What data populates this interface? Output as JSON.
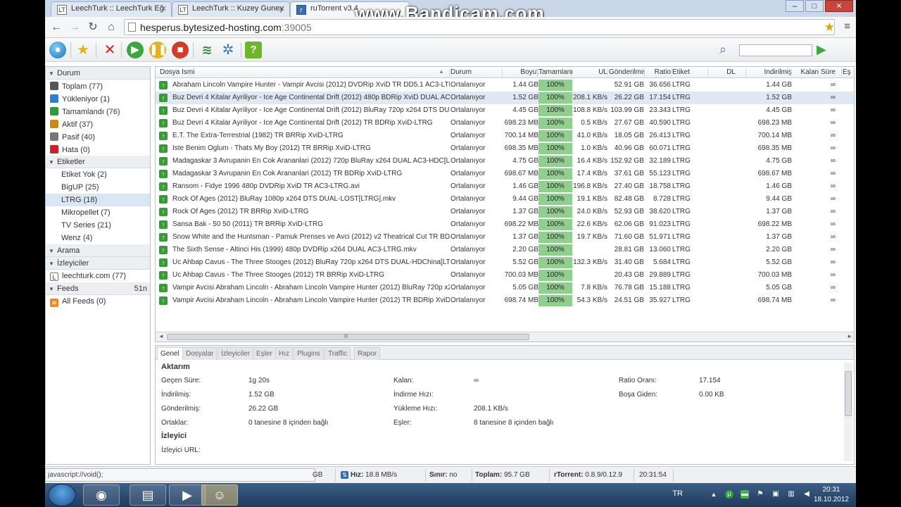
{
  "browser": {
    "tabs": [
      {
        "label": "LeechTurk :: LeechTurk Eğ",
        "favicon": "LT"
      },
      {
        "label": "LeechTurk :: Kuzey Guney",
        "favicon": "LT"
      },
      {
        "label": "ruTorrent v3.4",
        "favicon": "r"
      }
    ],
    "url_host": "hesperus.bytesized-hosting.com",
    "url_port": ":39005",
    "watermark": "www.Bandicam.com",
    "icons": {
      "back": "back-icon",
      "forward": "forward-icon",
      "reload": "reload-icon",
      "home": "home-icon",
      "star": "bookmark-star-icon",
      "wrench": "wrench-menu-icon"
    }
  },
  "sidebar": {
    "status_header": "Durum",
    "status_items": [
      {
        "label": "Toplam (77)",
        "color": "#555555"
      },
      {
        "label": "Yükleniyor (1)",
        "color": "#2f7fd0"
      },
      {
        "label": "Tamamlandı (76)",
        "color": "#2e9a3b"
      },
      {
        "label": "Aktif (37)",
        "color": "#c98a1a"
      },
      {
        "label": "Pasif (40)",
        "color": "#777777"
      },
      {
        "label": "Hata (0)",
        "color": "#cc2222"
      }
    ],
    "labels_header": "Etiketler",
    "label_items": [
      "Etiket Yok (2)",
      "BigUP (25)",
      "LTRG (18)",
      "Mikropellet (7)",
      "TV Series (21)",
      "Wenz (4)"
    ],
    "search_header": "Arama",
    "trackers_header": "İzleyiciler",
    "tracker_items": [
      "leechturk.com (77)"
    ],
    "feeds_header": "Feeds",
    "feeds_count": "51n",
    "feed_items": [
      "All Feeds (0)"
    ]
  },
  "table": {
    "columns": [
      "Dosya İsmi",
      "Durum",
      "Boyut",
      "Tamamlanı",
      "UL",
      "Gönderilmiş",
      "Ratio",
      "Etiket",
      "DL",
      "İndirilmiş",
      "Kalan Süre",
      "Eş"
    ],
    "rows": [
      [
        "Abraham Lincoln Vampire Hunter - Vampir Avcisi (2012) DVDRip XviD TR DD5.1 AC3-LTRG.avi",
        "Ortalanıyor",
        "1.44 GB",
        "100%",
        "",
        "52.91 GB",
        "36.656",
        "LTRG",
        "",
        "1.44 GB",
        "∞"
      ],
      [
        "Buz Devri 4 Kitalar Ayriliyor - Ice Age Continental Drift (2012) 480p BDRip XviD DUAL AC3-LTRG",
        "Ortalanıyor",
        "1.52 GB",
        "100%",
        "208.1 KB/s",
        "26.22 GB",
        "17.154",
        "LTRG",
        "",
        "1.52 GB",
        "∞"
      ],
      [
        "Buz Devri 4 Kitalar Ayriliyor - Ice Age Continental Drift (2012) BluRay 720p x264 DTS DUAL-LTRG",
        "Ortalanıyor",
        "4.45 GB",
        "100%",
        "108.8 KB/s",
        "103.99 GB",
        "23.343",
        "LTRG",
        "",
        "4.45 GB",
        "∞"
      ],
      [
        "Buz Devri 4 Kitalar Ayriliyor - Ice Age Continental Drift (2012) TR BDRip XviD-LTRG",
        "Ortalanıyor",
        "698.23 MB",
        "100%",
        "0.5 KB/s",
        "27.67 GB",
        "40.590",
        "LTRG",
        "",
        "698.23 MB",
        "∞"
      ],
      [
        "E.T. The Extra-Terrestrial (1982) TR BRRip XviD-LTRG",
        "Ortalanıyor",
        "700.14 MB",
        "100%",
        "41.0 KB/s",
        "18.05 GB",
        "26.413",
        "LTRG",
        "",
        "700.14 MB",
        "∞"
      ],
      [
        "Iste Benim Oglum - Thats My Boy (2012) TR BRRip XviD-LTRG",
        "Ortalanıyor",
        "698.35 MB",
        "100%",
        "1.0 KB/s",
        "40.96 GB",
        "60.071",
        "LTRG",
        "",
        "698.35 MB",
        "∞"
      ],
      [
        "Madagaskar 3 Avrupanin En Cok Arananlari (2012) 720p BluRay x264 DUAL AC3-HDC[LTRG]",
        "Ortalanıyor",
        "4.75 GB",
        "100%",
        "16.4 KB/s",
        "152.92 GB",
        "32.189",
        "LTRG",
        "",
        "4.75 GB",
        "∞"
      ],
      [
        "Madagaskar 3 Avrupanin En Cok Arananlari (2012) TR BDRip XviD-LTRG",
        "Ortalanıyor",
        "698.67 MB",
        "100%",
        "17.4 KB/s",
        "37.61 GB",
        "55.123",
        "LTRG",
        "",
        "698.67 MB",
        "∞"
      ],
      [
        "Ransom - Fidye 1996 480p DVDRip XviD TR AC3-LTRG.avi",
        "Ortalanıyor",
        "1.46 GB",
        "100%",
        "196.8 KB/s",
        "27.40 GB",
        "18.758",
        "LTRG",
        "",
        "1.46 GB",
        "∞"
      ],
      [
        "Rock Of Ages (2012) BluRay 1080p x264 DTS DUAL-LOST[LTRG].mkv",
        "Ortalanıyor",
        "9.44 GB",
        "100%",
        "19.1 KB/s",
        "82.48 GB",
        "8.728",
        "LTRG",
        "",
        "9.44 GB",
        "∞"
      ],
      [
        "Rock Of Ages (2012) TR BRRip XviD-LTRG",
        "Ortalanıyor",
        "1.37 GB",
        "100%",
        "24.0 KB/s",
        "52.93 GB",
        "38.620",
        "LTRG",
        "",
        "1.37 GB",
        "∞"
      ],
      [
        "Sansa Bak - 50 50 (2011) TR BRRip XviD-LTRG",
        "Ortalanıyor",
        "698.22 MB",
        "100%",
        "22.6 KB/s",
        "62.06 GB",
        "91.023",
        "LTRG",
        "",
        "698.22 MB",
        "∞"
      ],
      [
        "Snow White and the Huntsman - Pamuk Prenses ve Avci (2012) v2 Theatrical Cut TR BDRip XviD-LTRG",
        "Ortalanıyor",
        "1.37 GB",
        "100%",
        "19.7 KB/s",
        "71.60 GB",
        "51.971",
        "LTRG",
        "",
        "1.37 GB",
        "∞"
      ],
      [
        "The Sixth Sense - Altinci His (1999) 480p DVDRip x264 DUAL AC3-LTRG.mkv",
        "Ortalanıyor",
        "2.20 GB",
        "100%",
        "",
        "28.81 GB",
        "13.060",
        "LTRG",
        "",
        "2.20 GB",
        "∞"
      ],
      [
        "Uc Ahbap Cavus - The Three Stooges (2012) BluRay 720p x264 DTS DUAL-HDChina[LTRG].mkv",
        "Ortalanıyor",
        "5.52 GB",
        "100%",
        "132.3 KB/s",
        "31.40 GB",
        "5.684",
        "LTRG",
        "",
        "5.52 GB",
        "∞"
      ],
      [
        "Uc Ahbap Cavus - The Three Stooges (2012) TR BRRip XviD-LTRG",
        "Ortalanıyor",
        "700.03 MB",
        "100%",
        "",
        "20.43 GB",
        "29.889",
        "LTRG",
        "",
        "700.03 MB",
        "∞"
      ],
      [
        "Vampir Avcisi Abraham Lincoln - Abraham Lincoln Vampire Hunter (2012) BluRay 720p x264 DTS DUAL-LTRG",
        "Ortalanıyor",
        "5.05 GB",
        "100%",
        "7.8 KB/s",
        "76.78 GB",
        "15.188",
        "LTRG",
        "",
        "5.05 GB",
        "∞"
      ],
      [
        "Vampir Avcisi Abraham Lincoln - Abraham Lincoln Vampire Hunter (2012) TR BDRip XviD-LTRG",
        "Ortalanıyor",
        "698.74 MB",
        "100%",
        "54.3 KB/s",
        "24.51 GB",
        "35.927",
        "LTRG",
        "",
        "698.74 MB",
        "∞"
      ]
    ],
    "selected_row": 1,
    "scroll_thumb_label": "III"
  },
  "details": {
    "tabs": [
      "Genel",
      "Dosyalar",
      "İzleyiciler",
      "Eşler",
      "Hız",
      "Plugins",
      "Traffic",
      "Rapor"
    ],
    "transfer_header": "Aktarım",
    "fields": [
      {
        "label": "Geçen Süre:",
        "value": "1g 20s"
      },
      {
        "label": "İndirilmiş:",
        "value": "1.52 GB"
      },
      {
        "label": "Gönderilmiş:",
        "value": "26.22 GB"
      },
      {
        "label": "Ortaklar:",
        "value": "0 tanesine 8 içinden bağlı"
      },
      {
        "label": "Kalan:",
        "value": "∞"
      },
      {
        "label": "İndirme Hızı:",
        "value": ""
      },
      {
        "label": "Yükleme Hızı:",
        "value": "208.1 KB/s"
      },
      {
        "label": "Eşler:",
        "value": "8 tanesine 8 içinden bağlı"
      },
      {
        "label": "Ratio Oranı:",
        "value": "17.154"
      },
      {
        "label": "Boşa Giden:",
        "value": "0.00 KB"
      }
    ],
    "tracker_header": "İzleyici",
    "tracker_url_label": "İzleyici URL:"
  },
  "statusbar": {
    "js_url": "javascript://void();",
    "gb_fragment": "GB",
    "speed_label": "Hız:",
    "speed_value": "18.8 MB/s",
    "limit_label": "Sınır:",
    "limit_value": "no",
    "total_label": "Toplam:",
    "total_value": "95.7 GB",
    "rtorrent_label": "rTorrent:",
    "rtorrent_value": "0.8.9/0.12.9",
    "time": "20:31:54"
  },
  "taskbar": {
    "lang": "TR",
    "clock_time": "20:31",
    "clock_date": "18.10.2012"
  }
}
